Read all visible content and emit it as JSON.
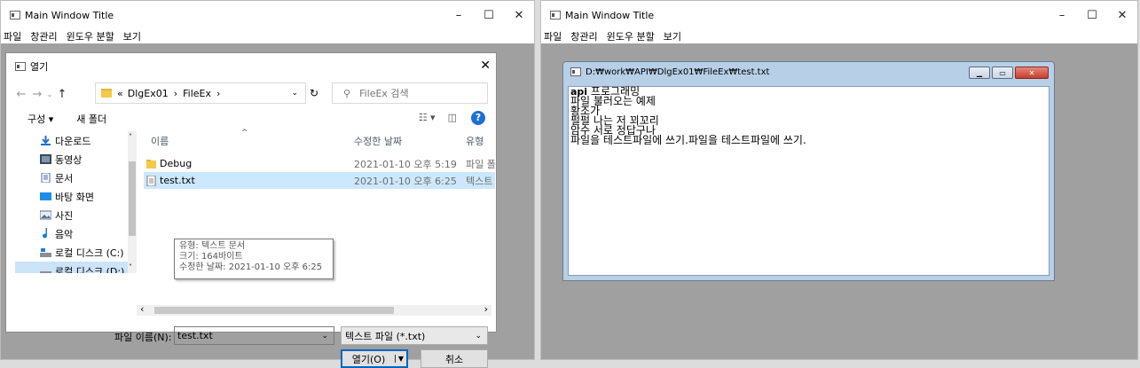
{
  "left_window": {
    "title": "Main Window Title",
    "menu": [
      "파일",
      "창관리",
      "윈도우 분할",
      "보기"
    ],
    "caption": {
      "minimize": "–",
      "maximize": "☐",
      "close": "✕"
    }
  },
  "open_dialog": {
    "title": "열기",
    "address": {
      "prefix": "«",
      "path": [
        "DlgEx01",
        "FileEx"
      ]
    },
    "search_placeholder": "FileEx 검색",
    "toolbar": {
      "organize": "구성 ▾",
      "new_folder": "새 폴더"
    },
    "nav_items": [
      "다운로드",
      "동영상",
      "문서",
      "바탕 화면",
      "사진",
      "음악",
      "로컬 디스크 (C:)",
      "로컬 디스크 (D:)"
    ],
    "columns": {
      "name": "이름",
      "date": "수정한 날짜",
      "type": "유형"
    },
    "files": [
      {
        "name": "Debug",
        "date": "2021-01-10 오후 5:19",
        "type": "파일 폴더"
      },
      {
        "name": "test.txt",
        "date": "2021-01-10 오후 6:25",
        "type": "텍스트 문서"
      }
    ],
    "tooltip": [
      "유형: 텍스트 문서",
      "크기: 164바이트",
      "수정한 날짜: 2021-01-10 오후 6:25"
    ],
    "filename_label": "파일 이름(N):",
    "filename_value": "test.txt",
    "filetype": "텍스트 파일 (*.txt)",
    "open_button": "열기(O)",
    "cancel_button": "취소"
  },
  "right_window": {
    "title": "Main Window Title",
    "menu": [
      "파일",
      "창관리",
      "윈도우 분할",
      "보기"
    ],
    "caption": {
      "minimize": "–",
      "maximize": "☐",
      "close": "✕"
    },
    "child": {
      "title": "D:₩work₩API₩DlgEx01₩FileEx₩test.txt",
      "lines": [
        "api 프로그래밍",
        "파일 불러오는 예제",
        "황조가",
        "펄펄 나는 저 꾀꼬리",
        "암수 서로 정답구나",
        "파일을 테스트파일에 쓰기.파일을 테스트파일에 쓰기."
      ]
    }
  }
}
